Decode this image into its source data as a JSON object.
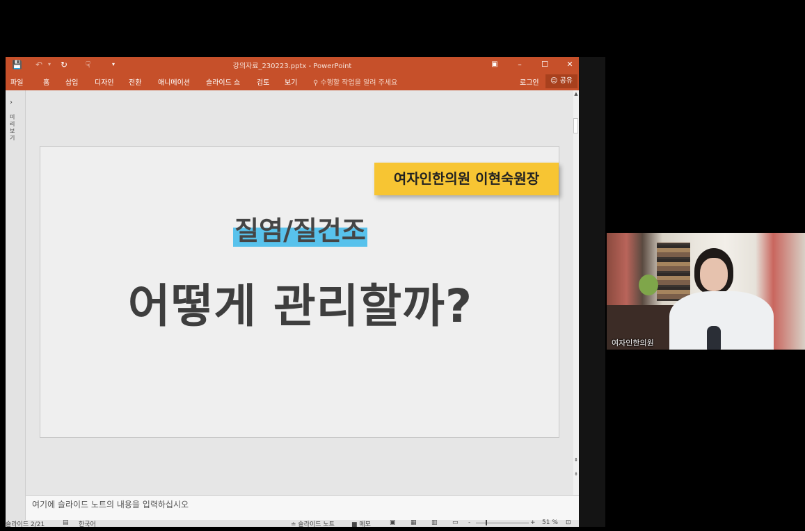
{
  "window": {
    "title": "강의자료_230223.pptx - PowerPoint",
    "quick_access": {
      "save_icon": "save-icon",
      "undo_icon": "undo-icon",
      "redo_icon": "redo-icon",
      "custom_icon": "touch-mode-icon",
      "more_icon": "customize-toolbar-icon"
    },
    "buttons": {
      "ribbon_options": "ribbon-display-options-icon",
      "minimize": "–",
      "maximize": "☐",
      "close": "✕"
    }
  },
  "ribbon": {
    "tabs": [
      "파일",
      "홈",
      "삽입",
      "디자인",
      "전환",
      "애니메이션",
      "슬라이드 쇼",
      "검토",
      "보기"
    ],
    "tell_me": "수행할 작업을 알려 주세요",
    "login": "로그인",
    "share": "공유"
  },
  "thumbnail_pane": {
    "collapse_label": "›",
    "vertical_label": "미리보기"
  },
  "slide": {
    "badge": "여자인한의원 이현숙원장",
    "topic": "질염/질건조",
    "headline": "어떻게 관리할까?"
  },
  "notes": {
    "placeholder": "여기에 슬라이드 노트의 내용을 입력하십시오"
  },
  "statusbar": {
    "slide_counter": "슬라이드 2/21",
    "language": "한국어",
    "notes_toggle": "슬라이드 노트",
    "comments_toggle": "메모",
    "zoom_minus": "-",
    "zoom_plus": "+",
    "zoom": "51 %"
  },
  "video": {
    "participant_name": "여자인한의원"
  },
  "colors": {
    "accent": "#c6502a",
    "badge": "#f7c533",
    "highlight": "#58c2ec",
    "headline": "#3e3e3e"
  }
}
